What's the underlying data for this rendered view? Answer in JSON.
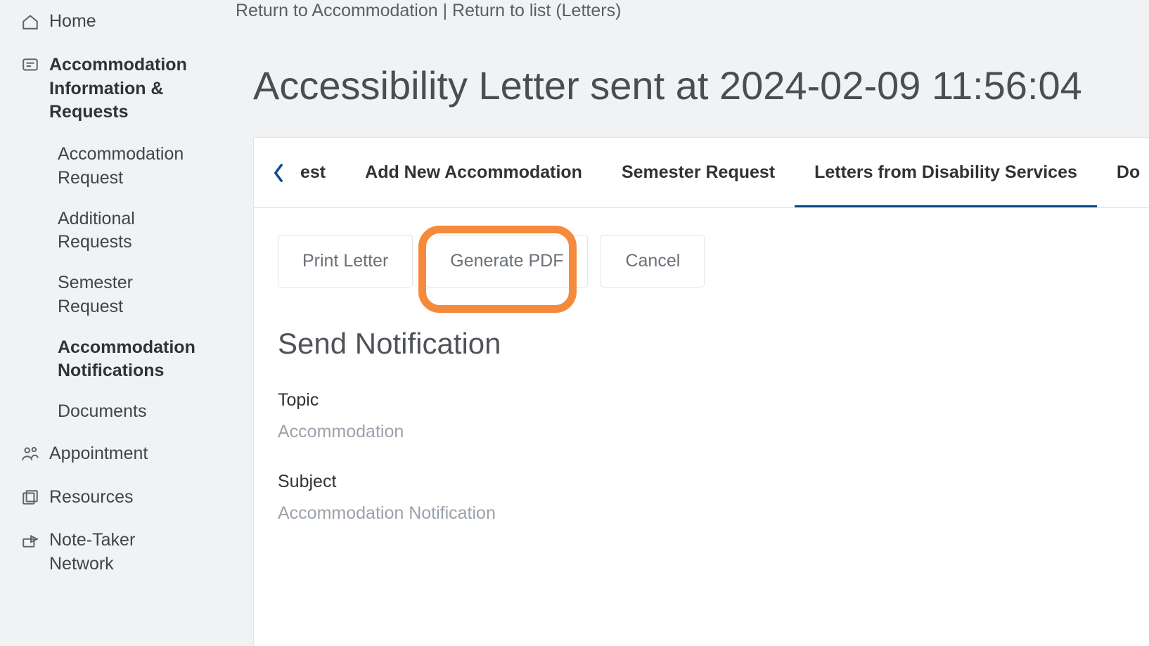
{
  "sidebar": {
    "home": "Home",
    "accommodation_group": "Accommodation Information & Requests",
    "accommodation_request": "Accommodation Request",
    "additional_requests": "Additional Requests",
    "semester_request": "Semester Request",
    "accommodation_notifications": "Accommodation Notifications",
    "documents": "Documents",
    "appointment": "Appointment",
    "resources": "Resources",
    "note_taker_network": "Note-Taker Network"
  },
  "breadcrumb": {
    "return_accommodation": "Return to Accommodation",
    "separator": " | ",
    "return_list": "Return to list (Letters)"
  },
  "page_title": "Accessibility Letter sent at 2024-02-09 11:56:04",
  "tabs": {
    "fragment_left": "est",
    "add_new_accommodation": "Add New Accommodation",
    "semester_request": "Semester Request",
    "letters_from_disability_services": "Letters from Disability Services",
    "fragment_right": "Do"
  },
  "buttons": {
    "print_letter": "Print Letter",
    "generate_pdf": "Generate PDF",
    "cancel": "Cancel"
  },
  "notification": {
    "section_heading": "Send Notification",
    "topic_label": "Topic",
    "topic_value": "Accommodation",
    "subject_label": "Subject",
    "subject_value": "Accommodation Notification"
  }
}
